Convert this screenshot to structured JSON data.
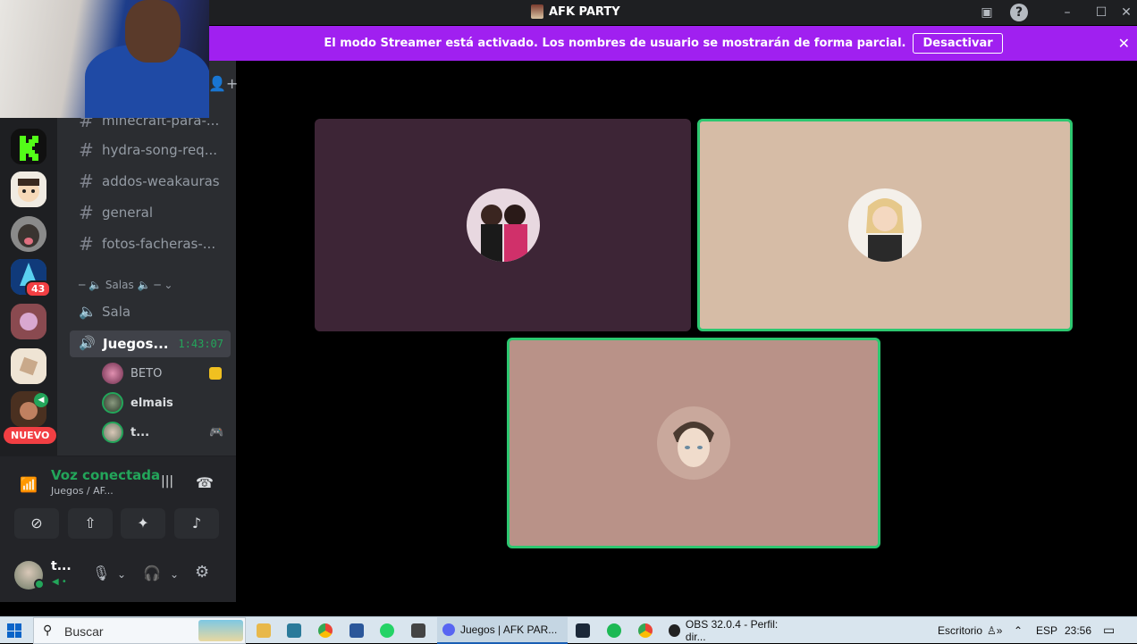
{
  "window": {
    "title": "AFK PARTY"
  },
  "banner": {
    "message": "El modo Streamer está activado. Los nombres de usuario se mostrarán de forma parcial.",
    "button_label": "Desactivar"
  },
  "rail": {
    "mentions_badge": "43",
    "new_label": "NUEVO"
  },
  "channels": {
    "text": [
      "minecraft-para-...",
      "hydra-song-req...",
      "addos-weakauras",
      "general",
      "fotos-facheras-..."
    ],
    "category": "Salas",
    "voice": [
      {
        "name": "Sala"
      },
      {
        "name": "Juegos...",
        "timer": "1:43:07"
      }
    ],
    "members": [
      {
        "name": "BETO"
      },
      {
        "name": "elmais"
      },
      {
        "name": "t..."
      }
    ]
  },
  "voice_panel": {
    "status": "Voz conectada",
    "location": "Juegos / AF..."
  },
  "user_panel": {
    "name": "t..."
  },
  "colors": {
    "banner": "#a020f0",
    "speaking_border": "#2dc770",
    "tile1_bg": "#3d2536",
    "tile2_bg": "#d6bca6",
    "tile3_bg": "#b99288"
  },
  "taskbar": {
    "search_placeholder": "Buscar",
    "tasks": [
      {
        "label": "Juegos | AFK PAR..."
      },
      {
        "label": "OBS 32.0.4 - Perfil: dir..."
      }
    ],
    "desktop_label": "Escritorio",
    "language": "ESP",
    "clock": "23:56"
  }
}
